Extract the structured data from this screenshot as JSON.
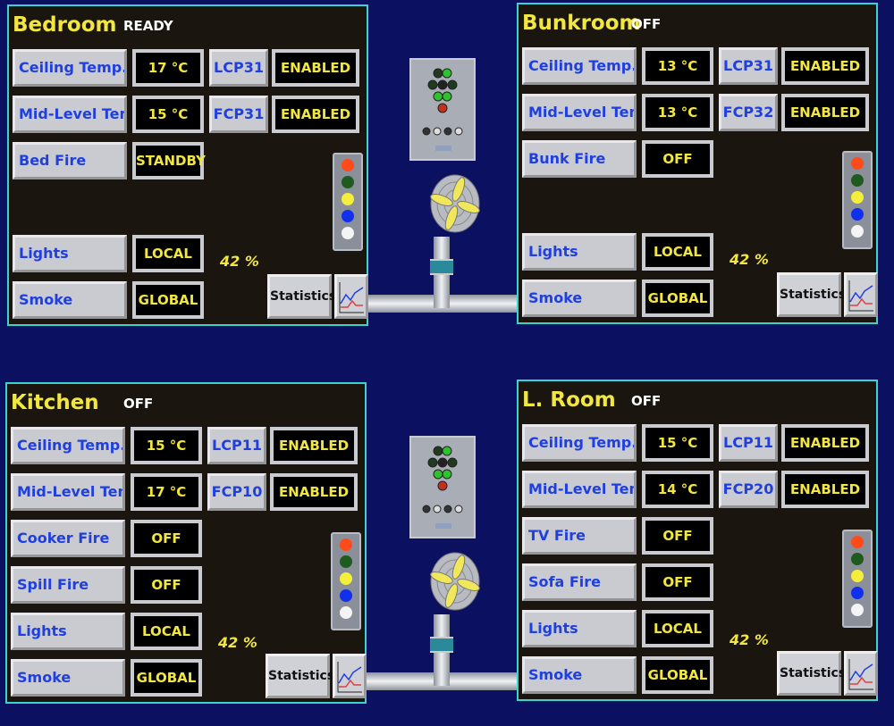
{
  "rooms": [
    {
      "name": "Bedroom",
      "status": "READY",
      "rows": [
        {
          "slot": 0,
          "label": "Ceiling Temp.",
          "value": "17  °C"
        },
        {
          "slot": 1,
          "label": "Mid-Level Temp",
          "value": "15  °C"
        },
        {
          "slot": 2,
          "label": "Bed Fire",
          "value": "STANDBY"
        },
        {
          "slot": 4,
          "label": "Lights",
          "value": "LOCAL"
        },
        {
          "slot": 5,
          "label": "Smoke",
          "value": "GLOBAL"
        }
      ],
      "controllers": [
        {
          "label": "LCP31",
          "value": "ENABLED"
        },
        {
          "label": "FCP31",
          "value": "ENABLED"
        }
      ],
      "percent": "42  %",
      "statistics": "Statistics"
    },
    {
      "name": "Bunkroom",
      "status": "OFF",
      "rows": [
        {
          "slot": 0,
          "label": "Ceiling Temp.",
          "value": "13  °C"
        },
        {
          "slot": 1,
          "label": "Mid-Level Temp.",
          "value": "13  °C"
        },
        {
          "slot": 2,
          "label": "Bunk Fire",
          "value": "OFF"
        },
        {
          "slot": 4,
          "label": "Lights",
          "value": "LOCAL"
        },
        {
          "slot": 5,
          "label": "Smoke",
          "value": "GLOBAL"
        }
      ],
      "controllers": [
        {
          "label": "LCP31",
          "value": "ENABLED"
        },
        {
          "label": "FCP32",
          "value": "ENABLED"
        }
      ],
      "percent": "42  %",
      "statistics": "Statistics"
    },
    {
      "name": "Kitchen",
      "status": "OFF",
      "rows": [
        {
          "slot": 0,
          "label": "Ceiling Temp.",
          "value": "15  °C"
        },
        {
          "slot": 1,
          "label": "Mid-Level Temp",
          "value": "17  °C"
        },
        {
          "slot": 2,
          "label": "Cooker Fire",
          "value": "OFF"
        },
        {
          "slot": 3,
          "label": "Spill Fire",
          "value": "OFF"
        },
        {
          "slot": 4,
          "label": "Lights",
          "value": "LOCAL"
        },
        {
          "slot": 5,
          "label": "Smoke",
          "value": "GLOBAL"
        }
      ],
      "controllers": [
        {
          "label": "LCP11",
          "value": "ENABLED"
        },
        {
          "label": "FCP10",
          "value": "ENABLED"
        }
      ],
      "percent": "42  %",
      "statistics": "Statistics"
    },
    {
      "name": "L. Room",
      "status": "OFF",
      "rows": [
        {
          "slot": 0,
          "label": "Ceiling Temp.",
          "value": "15  °C"
        },
        {
          "slot": 1,
          "label": "Mid-Level Temp.",
          "value": "14  °C"
        },
        {
          "slot": 2,
          "label": "TV Fire",
          "value": "OFF"
        },
        {
          "slot": 3,
          "label": "Sofa Fire",
          "value": "OFF"
        },
        {
          "slot": 4,
          "label": "Lights",
          "value": "LOCAL"
        },
        {
          "slot": 5,
          "label": "Smoke",
          "value": "GLOBAL"
        }
      ],
      "controllers": [
        {
          "label": "LCP11",
          "value": "ENABLED"
        },
        {
          "label": "FCP20",
          "value": "ENABLED"
        }
      ],
      "percent": "42  %",
      "statistics": "Statistics"
    }
  ],
  "colors": {
    "background": "#0b1060",
    "panel": "#1b150f",
    "border": "#3fd0d0",
    "accent_text": "#f2e640",
    "label_text": "#1f3fe0"
  },
  "indicator_lights": [
    "#ff4a1a",
    "#1f5a1f",
    "#f5ee3a",
    "#1030ee",
    "#f4f4f4"
  ],
  "icons": {
    "fan": "fan-icon",
    "control_unit": "control-panel-icon",
    "chart": "line-chart-icon"
  }
}
